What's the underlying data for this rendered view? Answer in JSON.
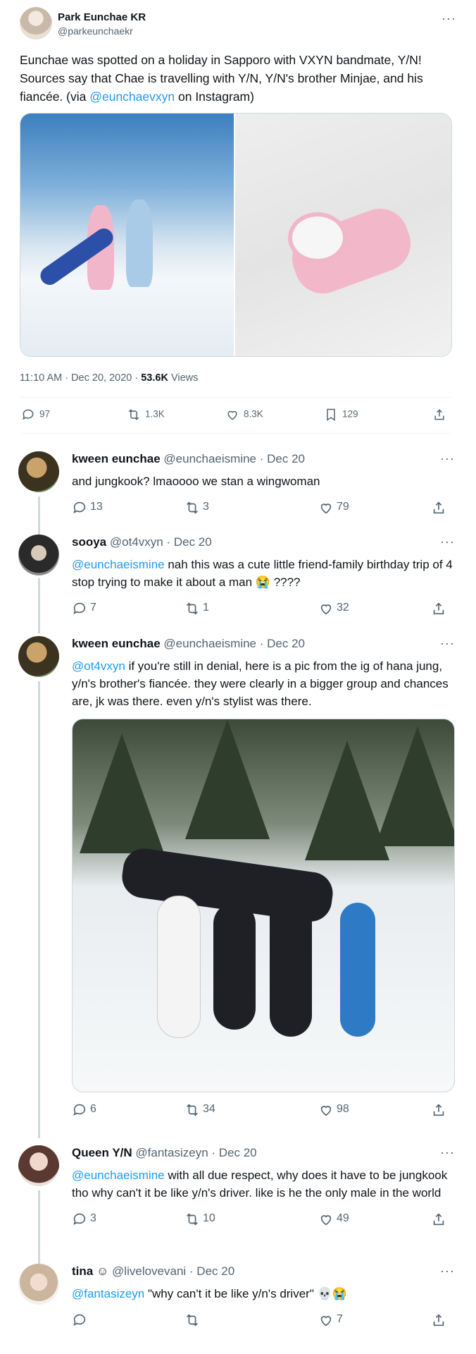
{
  "main_tweet": {
    "name": "Park Eunchae KR",
    "handle": "@parkeunchaekr",
    "more": "···",
    "text_part1": "Eunchae was spotted on a holiday in Sapporo with VXYN bandmate, Y/N! Sources say that Chae is travelling with Y/N, Y/N's brother Minjae, and his fiancée. (via ",
    "text_link": "@eunchaevxyn",
    "text_part2": " on Instagram)",
    "timestamp": "11:10 AM · Dec 20, 2020 · ",
    "views_count": "53.6K",
    "views_label": " Views",
    "replies": "97",
    "retweets": "1.3K",
    "likes": "8.3K",
    "bookmarks": "129"
  },
  "replies": [
    {
      "name": "kween eunchae",
      "handle": "@eunchaeismine",
      "date": " · Dec 20",
      "mention": "",
      "text": "and jungkook? lmaoooo we stan a wingwoman",
      "replies": "13",
      "retweets": "3",
      "likes": "79"
    },
    {
      "name": "sooya",
      "handle": "@ot4vxyn",
      "date": " · Dec 20",
      "mention": "@eunchaeismine",
      "text": " nah this was a cute little friend-family birthday trip of 4 stop trying to make it about a man 😭 ????",
      "replies": "7",
      "retweets": "1",
      "likes": "32"
    },
    {
      "name": "kween eunchae",
      "handle": "@eunchaeismine",
      "date": " · Dec 20",
      "mention": "@ot4vxyn",
      "text": " if you're still in denial, here is a pic from the ig of hana jung, y/n's brother's fiancée. they were clearly in a bigger group and chances are, jk was there. even y/n's stylist was there.",
      "replies": "6",
      "retweets": "34",
      "likes": "98"
    },
    {
      "name": "Queen Y/N",
      "handle": "@fantasizeyn",
      "date": " · Dec 20",
      "mention": "@eunchaeismine",
      "text": " with all due respect, why does it have to be jungkook tho why can't it be like y/n's driver. like is he the only male in the world",
      "replies": "3",
      "retweets": "10",
      "likes": "49"
    },
    {
      "name": "tina ☺",
      "handle": "@livelovevani",
      "date": " · Dec 20",
      "mention": "@fantasizeyn",
      "text": " \"why can't it be like y/n's driver\" 💀😭",
      "replies": "",
      "retweets": "",
      "likes": "7"
    }
  ],
  "icons": {
    "reply": "reply-icon",
    "retweet": "retweet-icon",
    "like": "heart-icon",
    "bookmark": "bookmark-icon",
    "share": "share-icon",
    "more": "more-icon"
  },
  "colors": {
    "link": "#1d9bf0",
    "muted": "#536471",
    "thread_line": "#cfd9de"
  }
}
